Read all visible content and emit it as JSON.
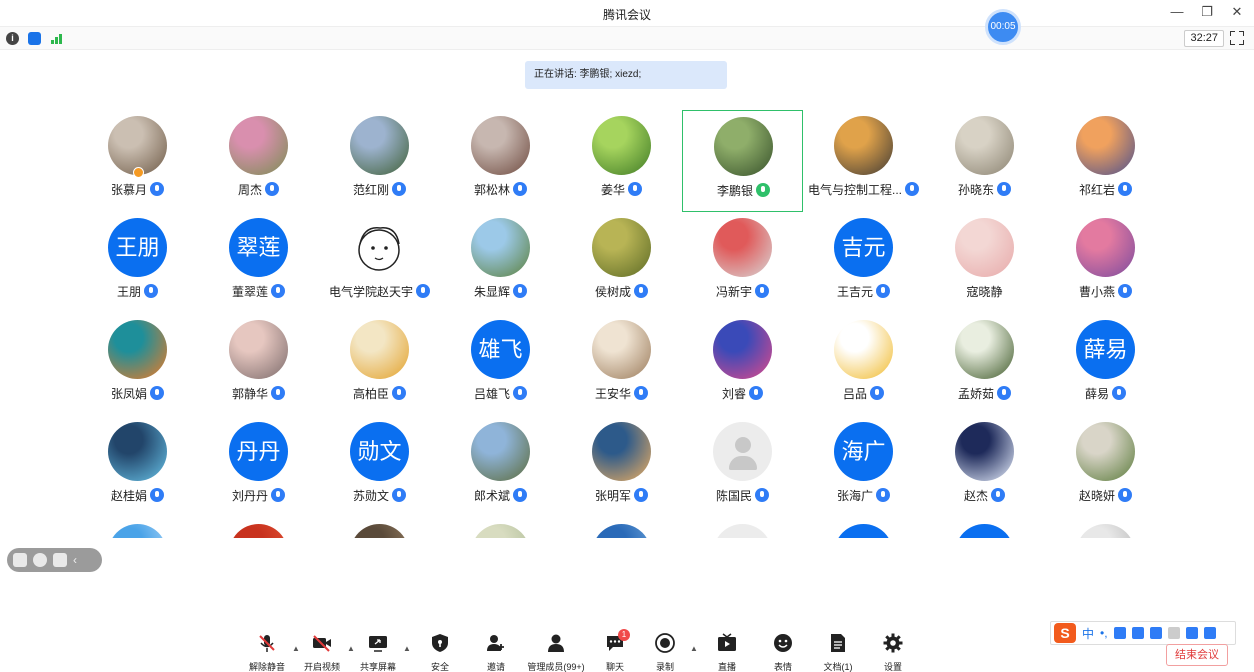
{
  "window": {
    "title": "腾讯会议"
  },
  "status": {
    "elapsed": "32:27",
    "recording_time": "00:05"
  },
  "speaker_banner": "正在讲话: 李鹏银; xiezd;",
  "participants": [
    {
      "name": "张慕月",
      "avatar": {
        "kind": "photo",
        "colors": [
          "#cbbfb2",
          "#6e5a46"
        ]
      },
      "mic": "muted",
      "host": true
    },
    {
      "name": "周杰",
      "avatar": {
        "kind": "photo",
        "colors": [
          "#d98fae",
          "#7a8e52"
        ]
      },
      "mic": "muted"
    },
    {
      "name": "范红刚",
      "avatar": {
        "kind": "photo",
        "colors": [
          "#9db3cf",
          "#3f5f36"
        ]
      },
      "mic": "muted"
    },
    {
      "name": "郭松林",
      "avatar": {
        "kind": "photo",
        "colors": [
          "#c7b7b0",
          "#6e4a3f"
        ]
      },
      "mic": "muted"
    },
    {
      "name": "姜华",
      "avatar": {
        "kind": "photo",
        "colors": [
          "#a6d45e",
          "#3f7a25"
        ]
      },
      "mic": "muted"
    },
    {
      "name": "李鹏银",
      "avatar": {
        "kind": "photo",
        "colors": [
          "#8fae6a",
          "#36502a"
        ]
      },
      "mic": "speaking",
      "active": true
    },
    {
      "name": "电气与控制工程...",
      "avatar": {
        "kind": "photo",
        "colors": [
          "#e0a24a",
          "#3f3a35"
        ]
      },
      "mic": "muted"
    },
    {
      "name": "孙晓东",
      "avatar": {
        "kind": "photo",
        "colors": [
          "#d8d2c5",
          "#8a8270"
        ]
      },
      "mic": "muted"
    },
    {
      "name": "祁红岩",
      "avatar": {
        "kind": "photo",
        "colors": [
          "#f0a15e",
          "#4b4f8e"
        ]
      },
      "mic": "muted"
    },
    {
      "name": "王朋",
      "avatar": {
        "kind": "text",
        "text": "王朋"
      },
      "mic": "muted"
    },
    {
      "name": "董翠莲",
      "avatar": {
        "kind": "text",
        "text": "翠莲"
      },
      "mic": "muted"
    },
    {
      "name": "电气学院赵天宇",
      "avatar": {
        "kind": "cartoon"
      },
      "mic": "muted"
    },
    {
      "name": "朱显辉",
      "avatar": {
        "kind": "photo",
        "colors": [
          "#9cc9e8",
          "#5a7f3a"
        ]
      },
      "mic": "muted"
    },
    {
      "name": "侯树成",
      "avatar": {
        "kind": "photo",
        "colors": [
          "#b8b455",
          "#5c6a25"
        ]
      },
      "mic": "on"
    },
    {
      "name": "冯新宇",
      "avatar": {
        "kind": "photo",
        "colors": [
          "#e05a5a",
          "#d8d8d8"
        ]
      },
      "mic": "muted"
    },
    {
      "name": "王吉元",
      "avatar": {
        "kind": "text",
        "text": "吉元"
      },
      "mic": "muted"
    },
    {
      "name": "寇晓静",
      "avatar": {
        "kind": "photo",
        "colors": [
          "#f3d7d4",
          "#e7a9a9"
        ]
      },
      "mic": "none"
    },
    {
      "name": "曹小燕",
      "avatar": {
        "kind": "photo",
        "colors": [
          "#e37aa0",
          "#7a4a9e"
        ]
      },
      "mic": "muted"
    },
    {
      "name": "张凤娟",
      "avatar": {
        "kind": "photo",
        "colors": [
          "#1e8f9a",
          "#f07a23"
        ]
      },
      "mic": "muted"
    },
    {
      "name": "郭静华",
      "avatar": {
        "kind": "photo",
        "colors": [
          "#e6c7c0",
          "#7b6a6a"
        ]
      },
      "mic": "muted"
    },
    {
      "name": "高柏臣",
      "avatar": {
        "kind": "photo",
        "colors": [
          "#f3e6c4",
          "#e3a12a"
        ]
      },
      "mic": "muted"
    },
    {
      "name": "吕雄飞",
      "avatar": {
        "kind": "text",
        "text": "雄飞"
      },
      "mic": "muted"
    },
    {
      "name": "王安华",
      "avatar": {
        "kind": "photo",
        "colors": [
          "#efe3d2",
          "#9a7a5a"
        ]
      },
      "mic": "muted"
    },
    {
      "name": "刘睿",
      "avatar": {
        "kind": "photo",
        "colors": [
          "#3a4ab8",
          "#e24a8a"
        ]
      },
      "mic": "muted"
    },
    {
      "name": "吕品",
      "avatar": {
        "kind": "photo",
        "colors": [
          "#ffffff",
          "#f0b92a"
        ]
      },
      "mic": "muted"
    },
    {
      "name": "孟娇茹",
      "avatar": {
        "kind": "photo",
        "colors": [
          "#e9eee0",
          "#3f5a2a"
        ]
      },
      "mic": "muted"
    },
    {
      "name": "薛易",
      "avatar": {
        "kind": "text",
        "text": "薛易"
      },
      "mic": "muted"
    },
    {
      "name": "赵桂娟",
      "avatar": {
        "kind": "photo",
        "colors": [
          "#22456a",
          "#68c3e8"
        ]
      },
      "mic": "muted"
    },
    {
      "name": "刘丹丹",
      "avatar": {
        "kind": "text",
        "text": "丹丹"
      },
      "mic": "muted"
    },
    {
      "name": "苏勋文",
      "avatar": {
        "kind": "text",
        "text": "勋文"
      },
      "mic": "muted"
    },
    {
      "name": "郎术斌",
      "avatar": {
        "kind": "photo",
        "colors": [
          "#8fb4d9",
          "#5b6a3a"
        ]
      },
      "mic": "muted"
    },
    {
      "name": "张明军",
      "avatar": {
        "kind": "photo",
        "colors": [
          "#2d5a8a",
          "#f0b060"
        ]
      },
      "mic": "muted"
    },
    {
      "name": "陈国民",
      "avatar": {
        "kind": "default"
      },
      "mic": "muted"
    },
    {
      "name": "张海广",
      "avatar": {
        "kind": "text",
        "text": "海广"
      },
      "mic": "muted"
    },
    {
      "name": "赵杰",
      "avatar": {
        "kind": "photo",
        "colors": [
          "#1e2a5a",
          "#e8f0ff"
        ]
      },
      "mic": "muted"
    },
    {
      "name": "赵晓妍",
      "avatar": {
        "kind": "photo",
        "colors": [
          "#d9d5c8",
          "#5a7a3a"
        ]
      },
      "mic": "muted"
    },
    {
      "name": "",
      "avatar": {
        "kind": "photo",
        "colors": [
          "#4aa3e8",
          "#bfe0fb"
        ]
      },
      "mic": "none"
    },
    {
      "name": "",
      "avatar": {
        "kind": "photo",
        "colors": [
          "#c8321e",
          "#e85a3a"
        ]
      },
      "mic": "none"
    },
    {
      "name": "",
      "avatar": {
        "kind": "photo",
        "colors": [
          "#5a4a3a",
          "#a58a6a"
        ]
      },
      "mic": "none"
    },
    {
      "name": "",
      "avatar": {
        "kind": "photo",
        "colors": [
          "#d8dcc0",
          "#a8b890"
        ]
      },
      "mic": "none"
    },
    {
      "name": "",
      "avatar": {
        "kind": "photo",
        "colors": [
          "#2a6ab8",
          "#7ab0e0"
        ]
      },
      "mic": "none"
    },
    {
      "name": "",
      "avatar": {
        "kind": "default"
      },
      "mic": "none"
    },
    {
      "name": "",
      "avatar": {
        "kind": "text",
        "text": ""
      },
      "mic": "none"
    },
    {
      "name": "",
      "avatar": {
        "kind": "text",
        "text": ""
      },
      "mic": "none"
    },
    {
      "name": "",
      "avatar": {
        "kind": "photo",
        "colors": [
          "#e8e8e8",
          "#b0b0b0"
        ]
      },
      "mic": "none"
    }
  ],
  "toolbar": [
    {
      "id": "unmute",
      "label": "解除静音",
      "icon": "mic-off-icon",
      "caret": true
    },
    {
      "id": "video",
      "label": "开启视频",
      "icon": "camera-off-icon",
      "caret": true
    },
    {
      "id": "share",
      "label": "共享屏幕",
      "icon": "screen-share-icon",
      "caret": true
    },
    {
      "id": "security",
      "label": "安全",
      "icon": "shield-icon"
    },
    {
      "id": "invite",
      "label": "邀请",
      "icon": "add-user-icon"
    },
    {
      "id": "members",
      "label": "管理成员(99+)",
      "icon": "members-icon"
    },
    {
      "id": "chat",
      "label": "聊天",
      "icon": "chat-icon",
      "badge": "1"
    },
    {
      "id": "record",
      "label": "录制",
      "icon": "record-icon",
      "caret": true
    },
    {
      "id": "live",
      "label": "直播",
      "icon": "live-icon"
    },
    {
      "id": "emoji",
      "label": "表情",
      "icon": "emoji-icon"
    },
    {
      "id": "docs",
      "label": "文档(1)",
      "icon": "document-icon"
    },
    {
      "id": "settings",
      "label": "设置",
      "icon": "settings-icon"
    }
  ],
  "ime": {
    "logo": "S",
    "mode": "中",
    "punct": "•,"
  },
  "end_meeting_label": "结束会议",
  "colors": {
    "accent": "#0a6ff0",
    "active_border": "#2fc06a",
    "end_red": "#e03a3a"
  }
}
